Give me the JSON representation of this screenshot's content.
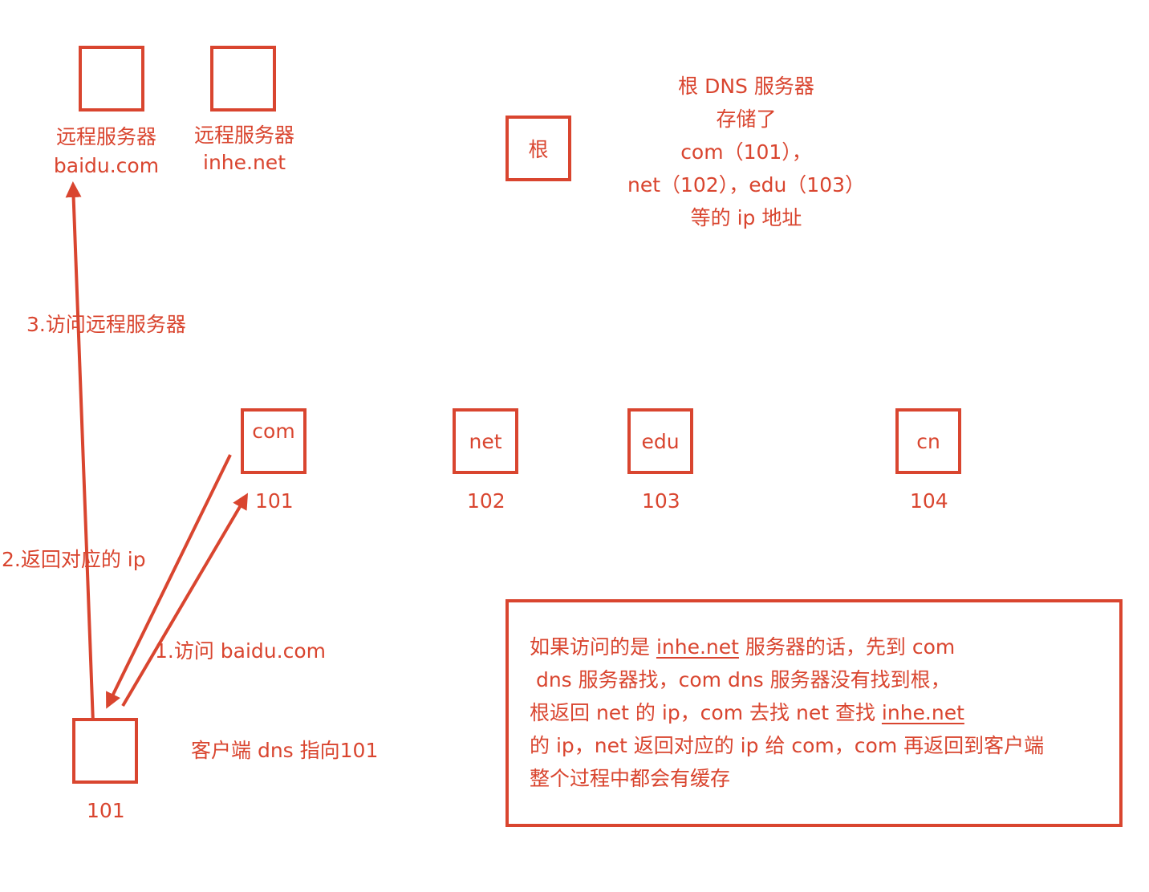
{
  "servers": [
    {
      "name": "远程服务器",
      "host": "baidu.com"
    },
    {
      "name": "远程服务器",
      "host": "inhe.net"
    }
  ],
  "root": {
    "box_label": "根",
    "desc": [
      "根 DNS 服务器",
      "存储了",
      "com（101），",
      "net（102），edu（103）",
      "等的 ip 地址"
    ]
  },
  "tld": [
    {
      "label": "com",
      "ip": "101"
    },
    {
      "label": "net",
      "ip": "102"
    },
    {
      "label": "edu",
      "ip": "103"
    },
    {
      "label": "cn",
      "ip": "104"
    }
  ],
  "client": {
    "ip": "101",
    "note": "客户端 dns 指向101"
  },
  "steps": {
    "step1": "1.访问 baidu.com",
    "step2": "2.返回对应的 ip",
    "step3": "3.访问远程服务器"
  },
  "note": {
    "line1_a": "如果访问的是 ",
    "line1_link": "inhe.net",
    "line1_b": " 服务器的话，先到 com",
    "line2": " dns 服务器找，com dns 服务器没有找到根，",
    "line3_a": "根返回 net 的 ip，com 去找 net 查找 ",
    "line3_link": "inhe.net",
    "line4": "的 ip，net 返回对应的 ip 给 com，com 再返回到客户端",
    "line5": "整个过程中都会有缓存"
  },
  "colors": {
    "accent": "#d9452f"
  }
}
